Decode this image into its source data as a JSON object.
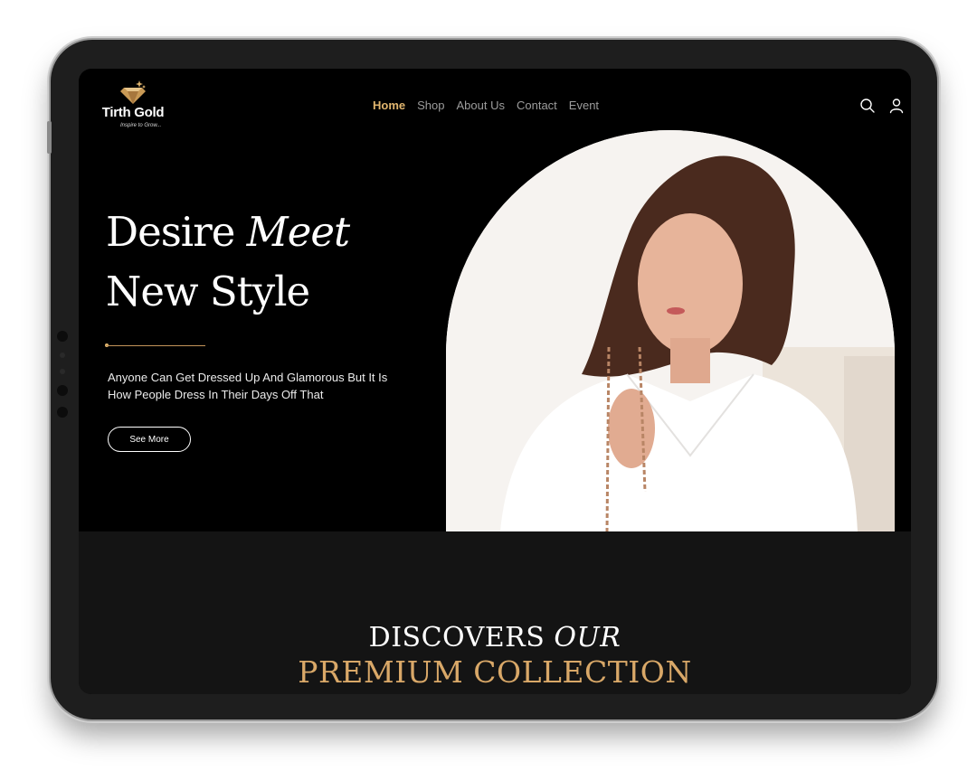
{
  "brand": {
    "name": "Tirth Gold",
    "tagline": "Inspire to Grow..."
  },
  "nav": {
    "items": [
      {
        "label": "Home",
        "active": true
      },
      {
        "label": "Shop",
        "active": false
      },
      {
        "label": "About Us",
        "active": false
      },
      {
        "label": "Contact",
        "active": false
      },
      {
        "label": "Event",
        "active": false
      }
    ]
  },
  "header_icons": [
    "search-icon",
    "user-icon"
  ],
  "hero": {
    "title_line1_a": "Desire",
    "title_line1_b": "Meet",
    "title_line2": "New Style",
    "description": "Anyone Can Get Dressed Up And Glamorous But It Is How People Dress In Their Days Off That",
    "cta_label": "See More"
  },
  "collection": {
    "line1_a": "DISCOVERS",
    "line1_b": "OUR",
    "line2": "PREMIUM COLLECTION"
  },
  "colors": {
    "accent_gold": "#e0b56e",
    "background": "#000000",
    "section_background": "#141414"
  }
}
